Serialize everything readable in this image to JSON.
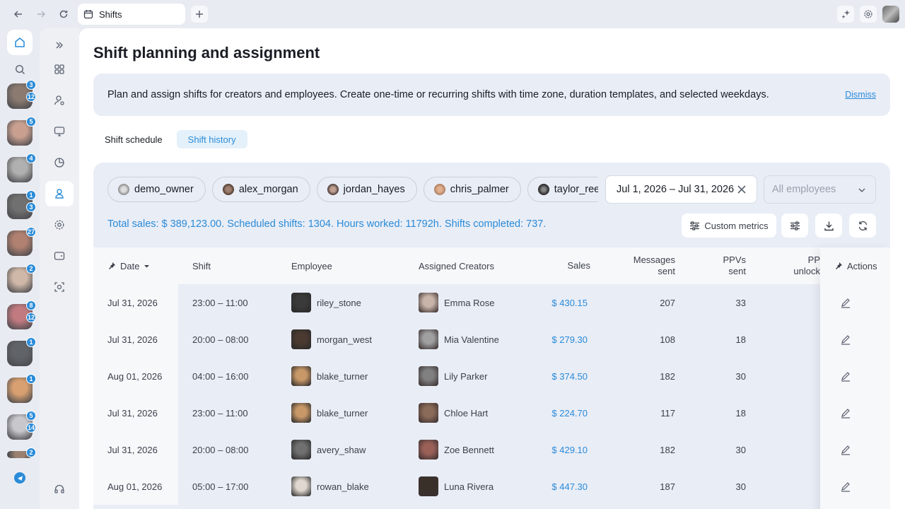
{
  "browser": {
    "tab_title": "Shifts"
  },
  "rail": {
    "creators": [
      {
        "badges": [
          "3",
          "12"
        ],
        "color": "#8a7a70"
      },
      {
        "badges": [
          "5"
        ],
        "color": "#c9a090"
      },
      {
        "badges": [
          "4"
        ],
        "color": "#b0b0b0"
      },
      {
        "badges": [
          "1",
          "3"
        ],
        "color": "#707070"
      },
      {
        "badges": [
          "27"
        ],
        "color": "#b08070"
      },
      {
        "badges": [
          "2"
        ],
        "color": "#d0b8a8"
      },
      {
        "badges": [
          "8",
          "12"
        ],
        "color": "#c07a80"
      },
      {
        "badges": [
          "1"
        ],
        "color": "#606468"
      },
      {
        "badges": [
          "1"
        ],
        "color": "#d8a070"
      },
      {
        "badges": [
          "5",
          "14"
        ],
        "color": "#c8c8cc"
      },
      {
        "badges": [
          "2"
        ],
        "color": "#9a8070"
      }
    ]
  },
  "page": {
    "title": "Shift planning and assignment",
    "banner_text": "Plan and assign shifts for creators and employees. Create one-time or recurring shifts with time zone, duration templates, and selected weekdays.",
    "dismiss_label": "Dismiss",
    "subtabs": [
      "Shift schedule",
      "Shift history"
    ]
  },
  "filters": {
    "chips": [
      "demo_owner",
      "alex_morgan",
      "jordan_hayes",
      "chris_palmer",
      "taylor_reed"
    ],
    "date_range": "Jul 1, 2026 – Jul 31, 2026",
    "employees_placeholder": "All employees"
  },
  "totals_text": "Total sales: $ 389,123.00. Scheduled shifts: 1304. Hours worked: 11792h. Shifts completed: 737.",
  "toolbar": {
    "custom_metrics_label": "Custom metrics"
  },
  "table": {
    "headers": {
      "date": "Date",
      "shift": "Shift",
      "employee": "Employee",
      "creators": "Assigned Creators",
      "sales": "Sales",
      "messages_1": "Messages",
      "messages_2": "sent",
      "ppvs_1": "PPVs",
      "ppvs_2": "sent",
      "ppv_unlock_1": "PP",
      "ppv_unlock_2": "unlock",
      "actions": "Actions"
    },
    "rows": [
      {
        "date": "Jul 31, 2026",
        "shift": "23:00 – 11:00",
        "employee": "riley_stone",
        "creator": "Emma Rose",
        "sales": "$ 430.15",
        "messages": "207",
        "ppvs": "33",
        "emp_color": "#3a3a3a",
        "cr_color": "#c8b4a8"
      },
      {
        "date": "Jul 31, 2026",
        "shift": "20:00 – 08:00",
        "employee": "morgan_west",
        "creator": "Mia Valentine",
        "sales": "$ 279.30",
        "messages": "108",
        "ppvs": "18",
        "emp_color": "#4a3a30",
        "cr_color": "#a0a0a0"
      },
      {
        "date": "Aug 01, 2026",
        "shift": "04:00 – 16:00",
        "employee": "blake_turner",
        "creator": "Lily Parker",
        "sales": "$ 374.50",
        "messages": "182",
        "ppvs": "30",
        "emp_color": "#c89868",
        "cr_color": "#808080"
      },
      {
        "date": "Jul 31, 2026",
        "shift": "23:00 – 11:00",
        "employee": "blake_turner",
        "creator": "Chloe Hart",
        "sales": "$ 224.70",
        "messages": "117",
        "ppvs": "18",
        "emp_color": "#c89868",
        "cr_color": "#8a6a58"
      },
      {
        "date": "Jul 31, 2026",
        "shift": "20:00 – 08:00",
        "employee": "avery_shaw",
        "creator": "Zoe Bennett",
        "sales": "$ 429.10",
        "messages": "182",
        "ppvs": "30",
        "emp_color": "#707070",
        "cr_color": "#9a6058"
      },
      {
        "date": "Aug 01, 2026",
        "shift": "05:00 – 17:00",
        "employee": "rowan_blake",
        "creator": "Luna Rivera",
        "sales": "$ 447.30",
        "messages": "187",
        "ppvs": "30",
        "emp_color": "#e0d8d0",
        "cr_color": "#3a302a"
      }
    ]
  }
}
